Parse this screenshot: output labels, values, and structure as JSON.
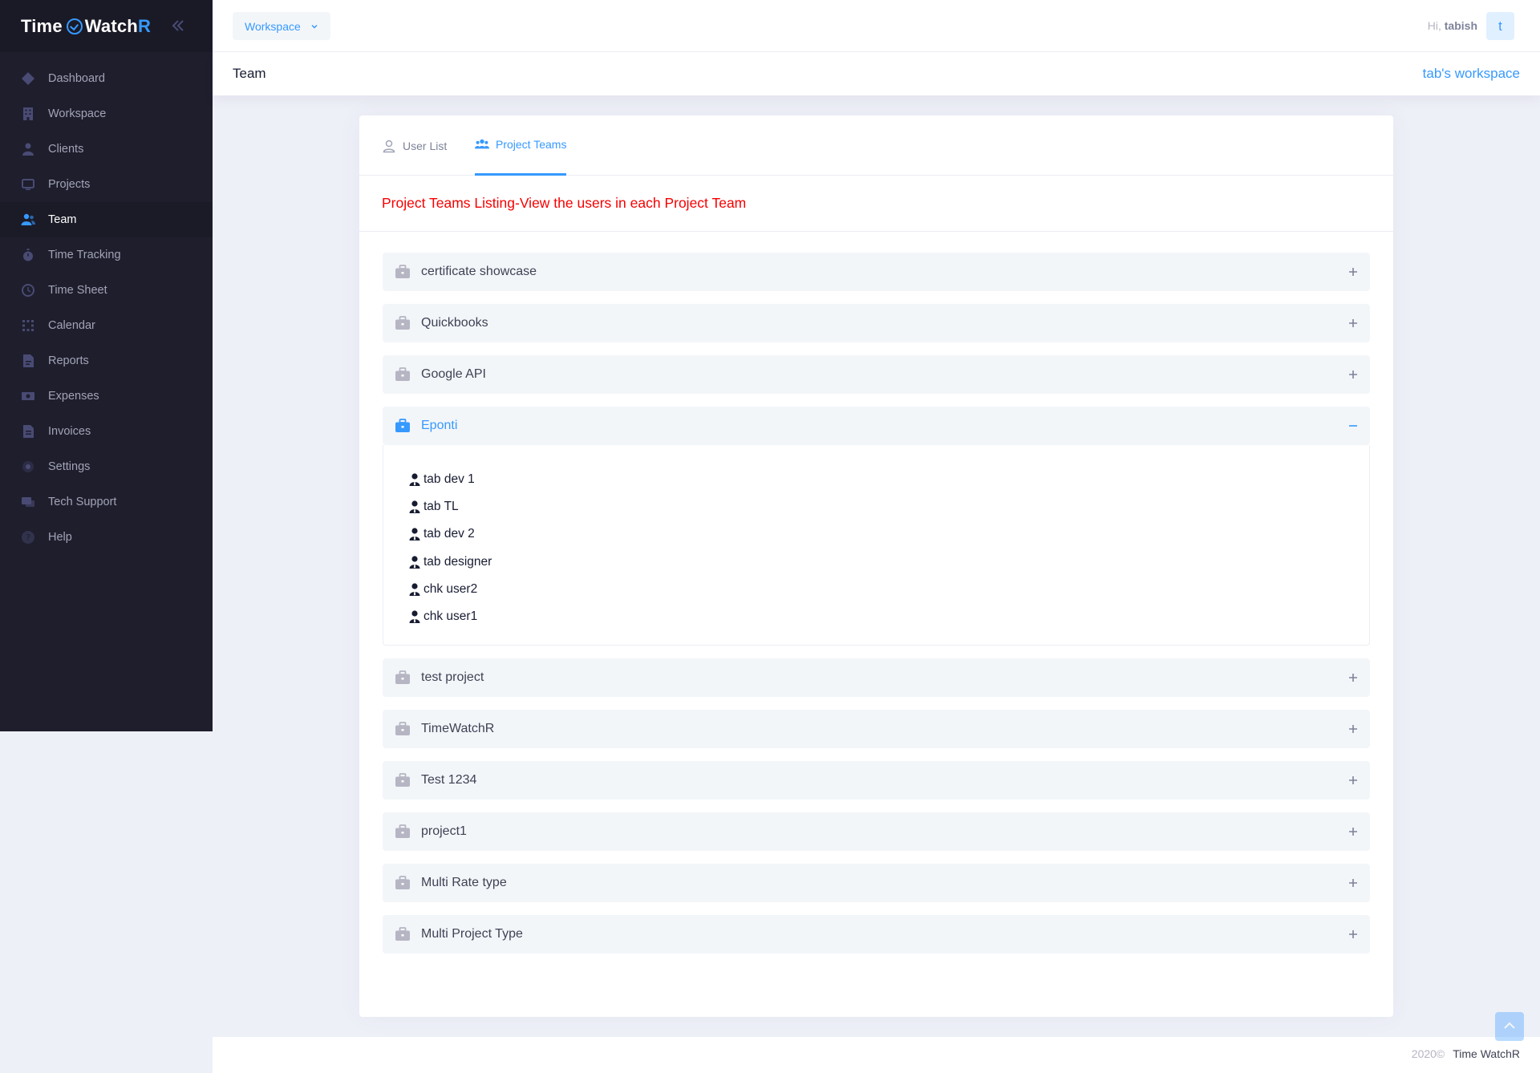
{
  "brand": {
    "part1": "Time",
    "part2": "Watch",
    "part3": "R"
  },
  "sidebar": {
    "items": [
      {
        "label": "Dashboard",
        "icon": "dashboard-icon",
        "active": false
      },
      {
        "label": "Workspace",
        "icon": "building-icon",
        "active": false
      },
      {
        "label": "Clients",
        "icon": "user-icon",
        "active": false
      },
      {
        "label": "Projects",
        "icon": "monitor-icon",
        "active": false
      },
      {
        "label": "Team",
        "icon": "team-icon",
        "active": true
      },
      {
        "label": "Time Tracking",
        "icon": "stopwatch-icon",
        "active": false
      },
      {
        "label": "Time Sheet",
        "icon": "clock-icon",
        "active": false
      },
      {
        "label": "Calendar",
        "icon": "calendar-icon",
        "active": false
      },
      {
        "label": "Reports",
        "icon": "report-icon",
        "active": false
      },
      {
        "label": "Expenses",
        "icon": "money-icon",
        "active": false
      },
      {
        "label": "Invoices",
        "icon": "invoice-icon",
        "active": false
      },
      {
        "label": "Settings",
        "icon": "gear-icon",
        "active": false
      },
      {
        "label": "Tech Support",
        "icon": "support-icon",
        "active": false
      },
      {
        "label": "Help",
        "icon": "help-icon",
        "active": false
      }
    ]
  },
  "header": {
    "workspace_button": "Workspace",
    "greeting": "Hi,",
    "username": "tabish",
    "avatar_letter": "t"
  },
  "subheader": {
    "title": "Team",
    "workspace_name": "tab's workspace"
  },
  "tabs": [
    {
      "label": "User List",
      "icon": "user-outline-icon",
      "active": false
    },
    {
      "label": "Project Teams",
      "icon": "users-icon",
      "active": true
    }
  ],
  "listing_title": "Project Teams Listing-View the users in each Project Team",
  "projects": [
    {
      "name": "certificate showcase",
      "open": false,
      "members": []
    },
    {
      "name": "Quickbooks",
      "open": false,
      "members": []
    },
    {
      "name": "Google API",
      "open": false,
      "members": []
    },
    {
      "name": "Eponti",
      "open": true,
      "members": [
        "tab dev 1",
        "tab TL",
        "tab dev 2",
        "tab designer",
        "chk user2",
        "chk user1"
      ]
    },
    {
      "name": "test project",
      "open": false,
      "members": []
    },
    {
      "name": "TimeWatchR",
      "open": false,
      "members": []
    },
    {
      "name": "Test 1234",
      "open": false,
      "members": []
    },
    {
      "name": "project1",
      "open": false,
      "members": []
    },
    {
      "name": "Multi Rate type",
      "open": false,
      "members": []
    },
    {
      "name": "Multi Project Type",
      "open": false,
      "members": []
    }
  ],
  "footer": {
    "year": "2020©",
    "brand": "Time WatchR"
  },
  "colors": {
    "accent": "#3699ff",
    "sidebar_bg": "#1e1e2d",
    "listing_title": "#f60000"
  }
}
